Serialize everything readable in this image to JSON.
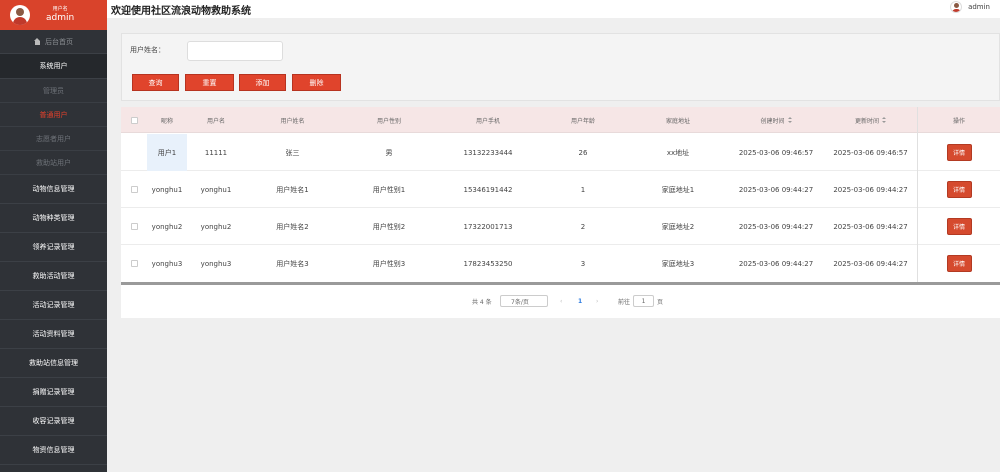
{
  "header": {
    "title": "欢迎使用社区流浪动物救助系统",
    "user": "admin"
  },
  "sidebar": {
    "user_role": "用户名",
    "user_name": "admin",
    "home": "后台首页",
    "system_user": "系统用户",
    "sub_items": [
      "管理员",
      "普通用户",
      "志愿者用户",
      "救助站用户"
    ],
    "menu": [
      "动物信息管理",
      "动物种类管理",
      "领养记录管理",
      "救助活动管理",
      "活动记录管理",
      "活动资料管理",
      "救助站信息管理",
      "捐赠记录管理",
      "收容记录管理",
      "物资信息管理"
    ]
  },
  "search": {
    "label": "用户姓名：",
    "input_value": "",
    "buttons": [
      "查询",
      "重置",
      "添加",
      "删除"
    ]
  },
  "table": {
    "headers": [
      "昵称",
      "用户名",
      "用户姓名",
      "用户性别",
      "用户手机",
      "用户年龄",
      "家庭地址",
      "创建时间",
      "更新时间",
      "操作"
    ],
    "rows": [
      [
        "用户1",
        "11111",
        "张三",
        "男",
        "13132233444",
        "26",
        "xx地址",
        "2025-03-06 09:46:57",
        "2025-03-06 09:46:57"
      ],
      [
        "yonghu1",
        "yonghu1",
        "用户姓名1",
        "用户性别1",
        "15346191442",
        "1",
        "家庭地址1",
        "2025-03-06 09:44:27",
        "2025-03-06 09:44:27"
      ],
      [
        "yonghu2",
        "yonghu2",
        "用户姓名2",
        "用户性别2",
        "17322001713",
        "2",
        "家庭地址2",
        "2025-03-06 09:44:27",
        "2025-03-06 09:44:27"
      ],
      [
        "yonghu3",
        "yonghu3",
        "用户姓名3",
        "用户性别3",
        "17823453250",
        "3",
        "家庭地址3",
        "2025-03-06 09:44:27",
        "2025-03-06 09:44:27"
      ]
    ],
    "detail_label": "详情"
  },
  "pagination": {
    "total": "共 4 条",
    "page_size": "7条/页",
    "prev": "‹",
    "current_page": "1",
    "next": "›",
    "goto_label": "前往",
    "goto_value": "1",
    "page_unit": "页"
  }
}
